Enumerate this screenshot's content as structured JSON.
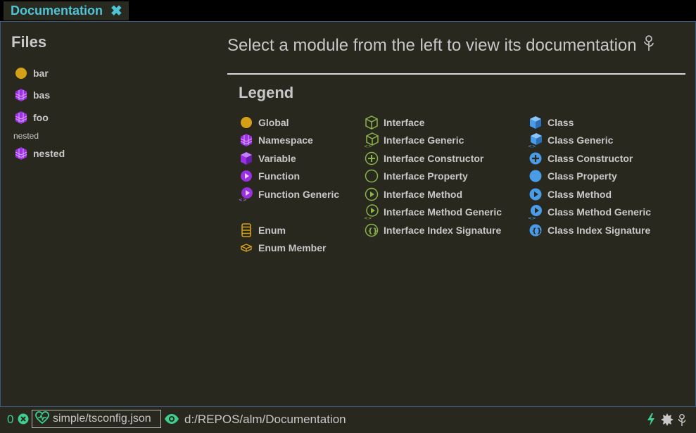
{
  "tab": {
    "title": "Documentation",
    "close_glyph": "✖"
  },
  "files": {
    "title": "Files",
    "items": [
      {
        "label": "bar",
        "icon": "global-icon"
      },
      {
        "label": "bas",
        "icon": "namespace-icon"
      },
      {
        "label": "foo",
        "icon": "namespace-icon"
      }
    ],
    "group_label": "nested",
    "group_items": [
      {
        "label": "nested",
        "icon": "namespace-icon"
      }
    ]
  },
  "main": {
    "heading": "Select a module from the left to view its documentation",
    "heading_icon": "flower-icon",
    "legend_title": "Legend",
    "legend": {
      "col1": [
        "Global",
        "Namespace",
        "Variable",
        "Function",
        "Function Generic",
        "Enum",
        "Enum Member"
      ],
      "col2": [
        "Interface",
        "Interface Generic",
        "Interface Constructor",
        "Interface Property",
        "Interface Method",
        "Interface Method Generic",
        "Interface Index Signature"
      ],
      "col3": [
        "Class",
        "Class Generic",
        "Class Constructor",
        "Class Property",
        "Class Method",
        "Class Method Generic",
        "Class Index Signature"
      ]
    }
  },
  "status": {
    "error_count": "0",
    "project": "simple/tsconfig.json",
    "path": "d:/REPOS/alm/Documentation"
  },
  "colors": {
    "global": "#d4a017",
    "namespace": "#9b30e0",
    "interface": "#8bb34a",
    "class": "#4a9be8",
    "enum": "#d4a017",
    "accent": "#3ecf8e",
    "tab": "#4fc3d7"
  }
}
